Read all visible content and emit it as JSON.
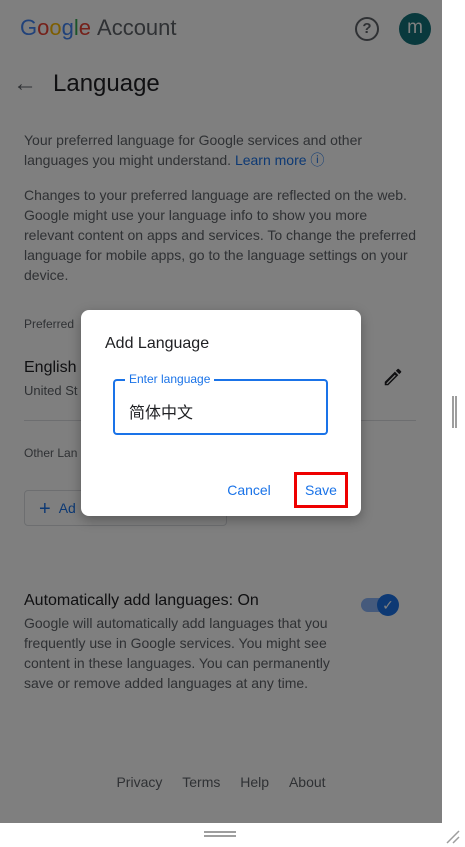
{
  "header": {
    "logo_letters": [
      "G",
      "o",
      "o",
      "g",
      "l",
      "e"
    ],
    "logo_suffix": "Account",
    "help_glyph": "?",
    "avatar_letter": "m"
  },
  "page": {
    "title": "Language",
    "intro_text": "Your preferred language for Google services and other languages you might understand.",
    "learn_more": "Learn more",
    "changes_text": "Changes to your preferred language are reflected on the web. Google might use your language info to show you more relevant content on apps and services. To change the preferred language for mobile apps, go to the language settings on your device."
  },
  "preferred": {
    "label": "Preferred",
    "language": "English",
    "region": "United St"
  },
  "other": {
    "label": "Other Lan",
    "add_button": "Ad"
  },
  "auto_add": {
    "title": "Automatically add languages: On",
    "description": "Google will automatically add languages that you frequently use in Google services. You might see content in these languages. You can permanently save or remove added languages at any time.",
    "enabled": true
  },
  "footer": {
    "links": [
      "Privacy",
      "Terms",
      "Help",
      "About"
    ]
  },
  "dialog": {
    "title": "Add Language",
    "field_label": "Enter language",
    "field_value": "简体中文",
    "cancel_label": "Cancel",
    "save_label": "Save"
  },
  "colors": {
    "accent": "#1a73e8",
    "avatar": "#12737a",
    "highlight_border": "#ee0000"
  }
}
